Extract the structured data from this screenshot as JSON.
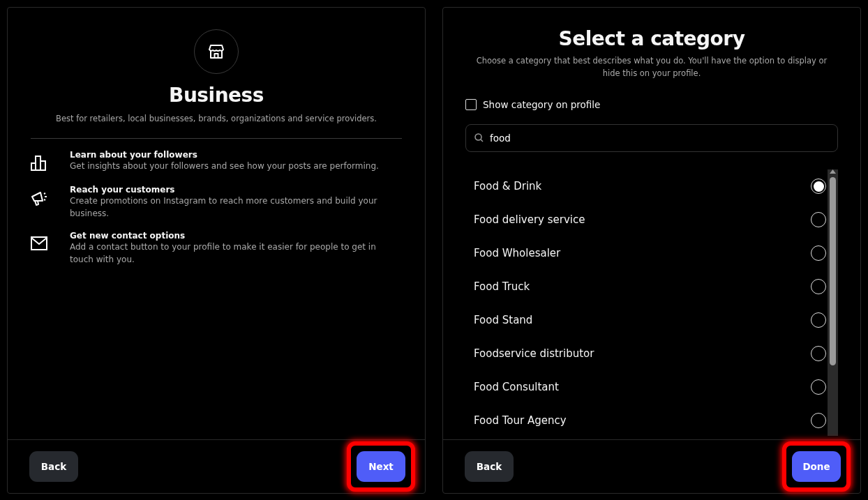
{
  "business_panel": {
    "title": "Business",
    "subtitle": "Best for retailers, local businesses, brands, organizations and service providers.",
    "features": [
      {
        "kind": "chart",
        "title": "Learn about your followers",
        "description": "Get insights about your followers and see how your posts are performing."
      },
      {
        "kind": "megaphone",
        "title": "Reach your customers",
        "description": "Create promotions on Instagram to reach more customers and build your business."
      },
      {
        "kind": "mail",
        "title": "Get new contact options",
        "description": "Add a contact button to your profile to make it easier for people to get in touch with you."
      }
    ],
    "buttons": [
      {
        "kind": "secondary",
        "label": "Back",
        "highlighted": false
      },
      {
        "kind": "primary",
        "label": "Next",
        "highlighted": true
      }
    ]
  },
  "category_panel": {
    "title": "Select a category",
    "subtitle": "Choose a category that best describes what you do. You'll have the option to display or hide this on your profile.",
    "show_on_profile": {
      "label": "Show category on profile",
      "checked": false
    },
    "search": {
      "value": "food"
    },
    "categories": [
      {
        "label": "Food & Drink",
        "selected": true
      },
      {
        "label": "Food delivery service",
        "selected": false
      },
      {
        "label": "Food Wholesaler",
        "selected": false
      },
      {
        "label": "Food Truck",
        "selected": false
      },
      {
        "label": "Food Stand",
        "selected": false
      },
      {
        "label": "Foodservice distributor",
        "selected": false
      },
      {
        "label": "Food Consultant",
        "selected": false
      },
      {
        "label": "Food Tour Agency",
        "selected": false
      }
    ],
    "buttons": [
      {
        "kind": "secondary",
        "label": "Back",
        "highlighted": false
      },
      {
        "kind": "primary",
        "label": "Done",
        "highlighted": true
      }
    ]
  }
}
